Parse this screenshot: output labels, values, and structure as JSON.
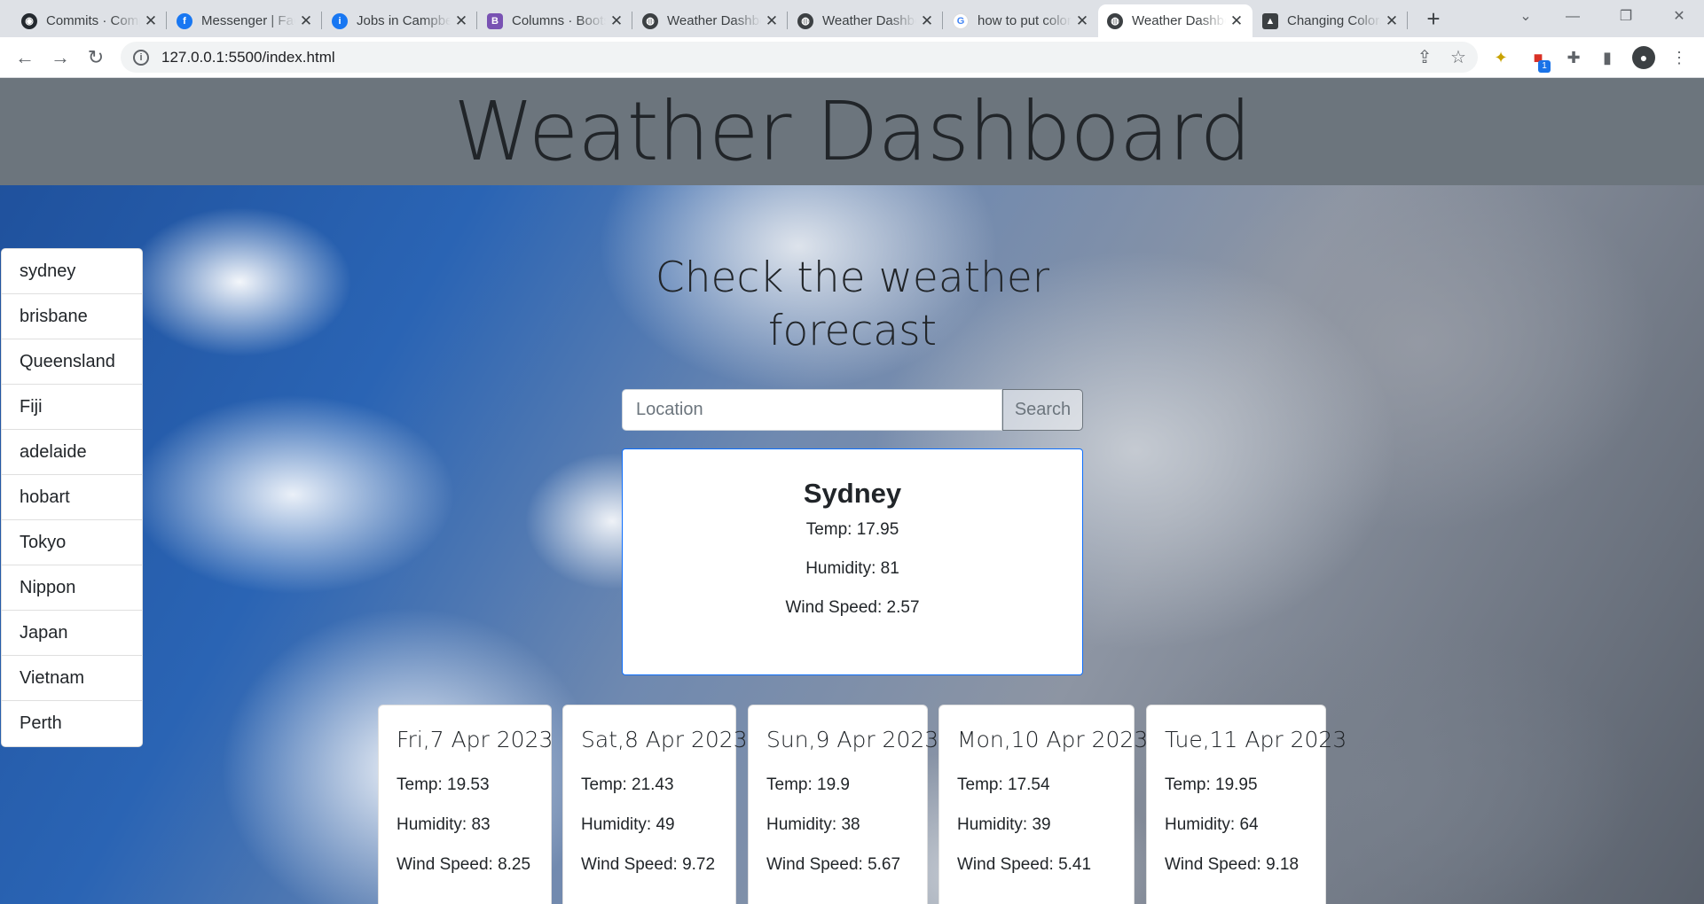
{
  "browser": {
    "tabs": [
      {
        "title": "Commits · Computer",
        "icon": "github-icon"
      },
      {
        "title": "Messenger | Facebook",
        "icon": "facebook-icon"
      },
      {
        "title": "Jobs in Campbelltown",
        "icon": "facebook-jobs-icon"
      },
      {
        "title": "Columns · Bootstrap",
        "icon": "bootstrap-icon"
      },
      {
        "title": "Weather Dashboard",
        "icon": "globe-icon"
      },
      {
        "title": "Weather Dashboard",
        "icon": "globe-icon"
      },
      {
        "title": "how to put color",
        "icon": "google-icon"
      },
      {
        "title": "Weather Dashboard",
        "icon": "globe-icon",
        "active": true
      },
      {
        "title": "Changing Colors",
        "icon": "mortarboard-icon"
      }
    ],
    "url": "127.0.0.1:5500/index.html",
    "extension_badge": "1"
  },
  "page": {
    "title": "Weather Dashboard",
    "subtitle": "Check the weather forecast",
    "search": {
      "placeholder": "Location",
      "button_label": "Search",
      "value": ""
    },
    "history": [
      "sydney",
      "brisbane",
      "Queensland",
      "Fiji",
      "adelaide",
      "hobart",
      "Tokyo",
      "Nippon",
      "Japan",
      "Vietnam",
      "Perth"
    ],
    "current": {
      "city": "Sydney",
      "temp": "Temp: 17.95",
      "humidity": "Humidity: 81",
      "wind": "Wind Speed: 2.57"
    },
    "forecast": [
      {
        "date": "Fri,7 Apr 2023",
        "temp": "Temp: 19.53",
        "humidity": "Humidity: 83",
        "wind": "Wind Speed: 8.25"
      },
      {
        "date": "Sat,8 Apr 2023",
        "temp": "Temp: 21.43",
        "humidity": "Humidity: 49",
        "wind": "Wind Speed: 9.72"
      },
      {
        "date": "Sun,9 Apr 2023",
        "temp": "Temp: 19.9",
        "humidity": "Humidity: 38",
        "wind": "Wind Speed: 5.67"
      },
      {
        "date": "Mon,10 Apr 2023",
        "temp": "Temp: 17.54",
        "humidity": "Humidity: 39",
        "wind": "Wind Speed: 5.41"
      },
      {
        "date": "Tue,11 Apr 2023",
        "temp": "Temp: 19.95",
        "humidity": "Humidity: 64",
        "wind": "Wind Speed: 9.18"
      }
    ]
  }
}
